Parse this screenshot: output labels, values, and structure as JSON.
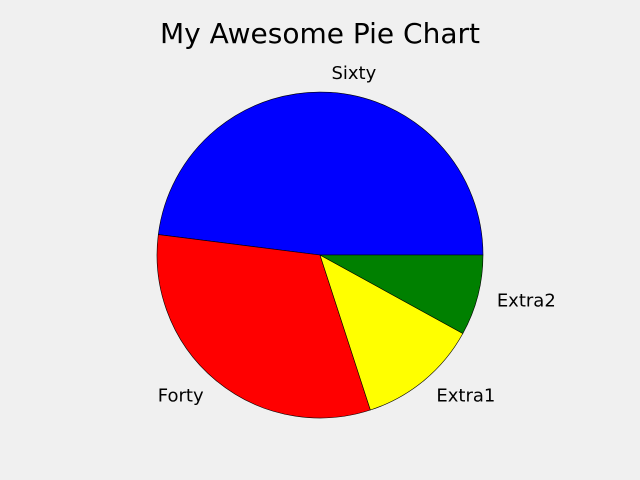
{
  "chart_data": {
    "type": "pie",
    "title": "My Awesome Pie Chart",
    "categories": [
      "Sixty",
      "Forty",
      "Extra1",
      "Extra2"
    ],
    "values": [
      60,
      40,
      15,
      10
    ],
    "colors": [
      "#0000ff",
      "#ff0000",
      "#ffff00",
      "#008000"
    ],
    "start_angle_deg": 0,
    "direction": "counterclockwise",
    "legend": "none"
  }
}
